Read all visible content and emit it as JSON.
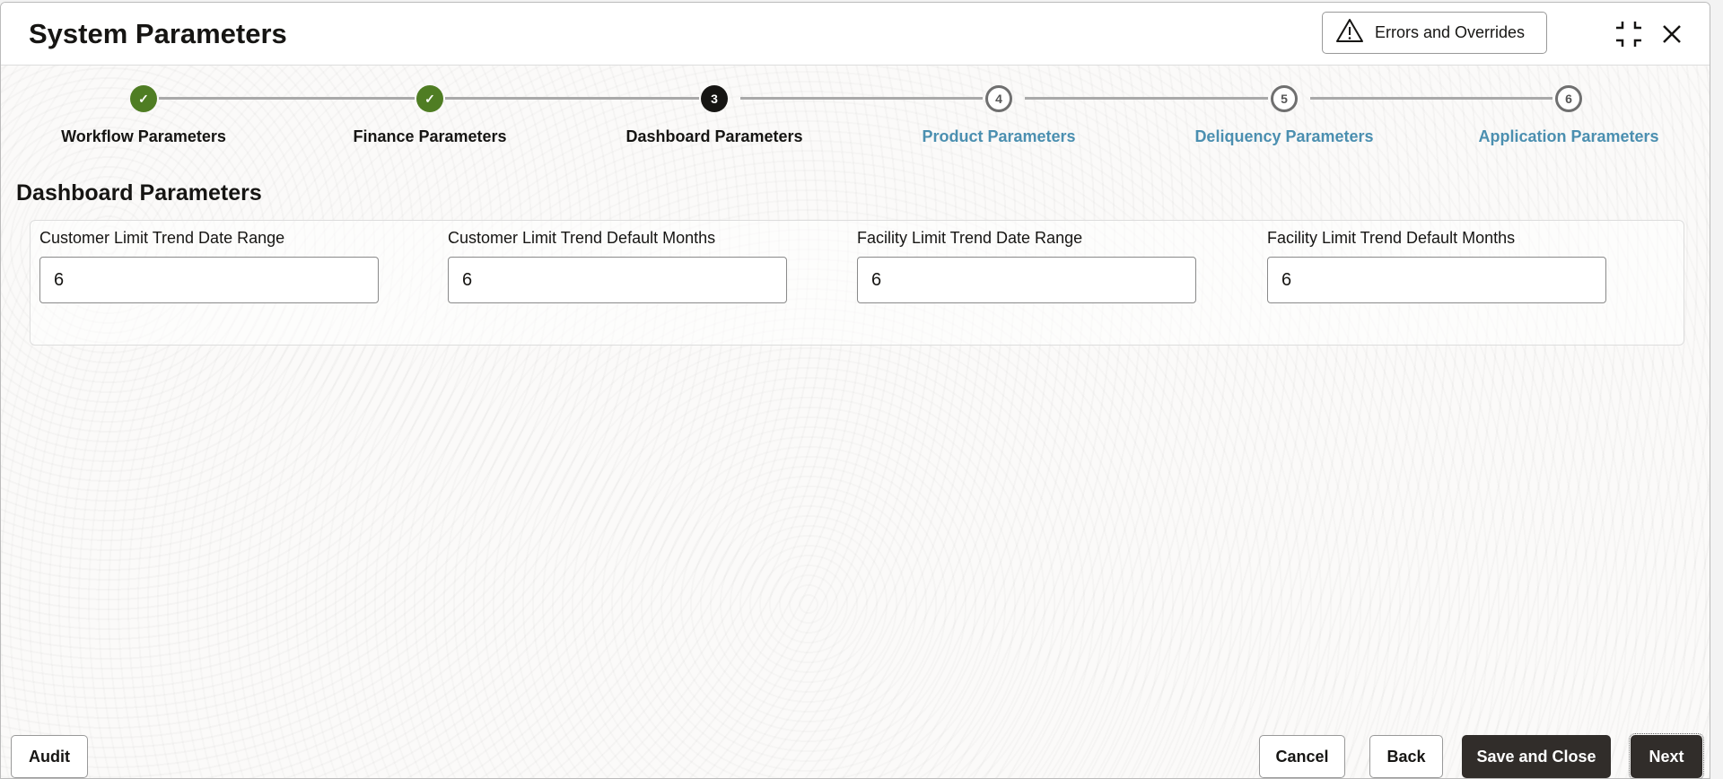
{
  "header": {
    "title": "System Parameters",
    "errors_button": "Errors and Overrides"
  },
  "steps": [
    {
      "number": "1",
      "label": "Workflow Parameters",
      "status": "done"
    },
    {
      "number": "2",
      "label": "Finance Parameters",
      "status": "done"
    },
    {
      "number": "3",
      "label": "Dashboard Parameters",
      "status": "current"
    },
    {
      "number": "4",
      "label": "Product Parameters",
      "status": "todo"
    },
    {
      "number": "5",
      "label": "Deliquency Parameters",
      "status": "todo"
    },
    {
      "number": "6",
      "label": "Application Parameters",
      "status": "todo"
    }
  ],
  "section": {
    "title": "Dashboard Parameters",
    "fields": [
      {
        "label": "Customer Limit Trend Date Range",
        "value": "6"
      },
      {
        "label": "Customer Limit Trend Default Months",
        "value": "6"
      },
      {
        "label": "Facility Limit Trend Date Range",
        "value": "6"
      },
      {
        "label": "Facility Limit Trend Default Months",
        "value": "6"
      }
    ]
  },
  "footer": {
    "audit": "Audit",
    "cancel": "Cancel",
    "back": "Back",
    "save_close": "Save and Close",
    "next": "Next"
  },
  "colors": {
    "done": "#4f7d23",
    "link": "#4b8fb0",
    "dark": "#312d2a"
  }
}
